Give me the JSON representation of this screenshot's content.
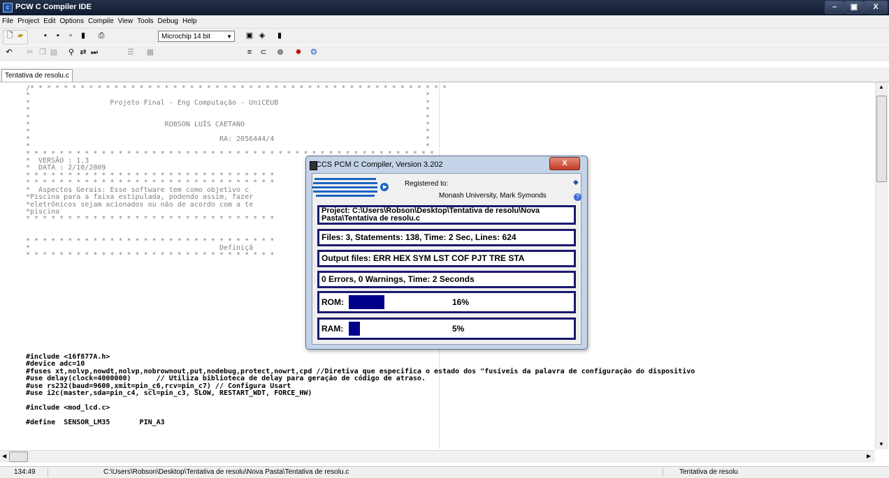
{
  "window": {
    "title": "PCW C Compiler IDE",
    "minimize": "–",
    "maximize": "▣",
    "close": "X"
  },
  "menu": [
    "File",
    "Project",
    "Edit",
    "Options",
    "Compile",
    "View",
    "Tools",
    "Debug",
    "Help"
  ],
  "toolbar": {
    "chip_select": "Microchip 14 bit"
  },
  "tab": {
    "label": "Tentativa de resolu.c"
  },
  "code_lines": [
    {
      "t": "/* * * * * * * * * * * * * * * * * * * * * * * * * * * * * * * * * * * * * * * * * * * * * * * * * *",
      "c": "cm"
    },
    {
      "t": "*                                                                                              *",
      "c": "cm"
    },
    {
      "t": "*                   Projeto Final - Eng Computação - UniCEUB                                   *",
      "c": "cm"
    },
    {
      "t": "*                                                                                              *",
      "c": "cm"
    },
    {
      "t": "*                                                                                              *",
      "c": "cm"
    },
    {
      "t": "*                                ROBSON LUÍS CAETANO                                           *",
      "c": "cm"
    },
    {
      "t": "*                                                                                              *",
      "c": "cm"
    },
    {
      "t": "*                                             RA: 2056444/4                                    *",
      "c": "cm"
    },
    {
      "t": "*                                                                                              *",
      "c": "cm"
    },
    {
      "t": "* * * * * * * * * * * * * * * * * * * * * * * * * * * * * * * * * * * * * * * * * * * * * * * * *",
      "c": "cm"
    },
    {
      "t": "*  VERSÃO : 1.3",
      "c": "cm"
    },
    {
      "t": "*  DATA : 2/10/2009",
      "c": "cm"
    },
    {
      "t": "* * * * * * * * * * * * * * * * * * * * * * * * * * * * * *",
      "c": "cm"
    },
    {
      "t": "* * * * * * * * * * * * * * * * * * * * * * * * * * * * * *",
      "c": "cm"
    },
    {
      "t": "*  Aspectos Gerais: Esse software tem como objetivo c",
      "c": "cm"
    },
    {
      "t": "*Piscina para a faixa estipulada, podendo assim, fazer",
      "c": "cm"
    },
    {
      "t": "*eletrônicos sejam acionados ou não de acordo com a te",
      "c": "cm"
    },
    {
      "t": "*piscina",
      "c": "cm"
    },
    {
      "t": "* * * * * * * * * * * * * * * * * * * * * * * * * * * * * *",
      "c": "cm"
    },
    {
      "t": "",
      "c": "cm"
    },
    {
      "t": "",
      "c": "cm"
    },
    {
      "t": "* * * * * * * * * * * * * * * * * * * * * * * * * * * * * *",
      "c": "cm"
    },
    {
      "t": "*                                             Definiçã",
      "c": "cm"
    },
    {
      "t": "* * * * * * * * * * * * * * * * * * * * * * * * * * * * * *",
      "c": "cm"
    },
    {
      "t": "",
      "c": "cm"
    },
    {
      "t": "",
      "c": "cm"
    },
    {
      "t": "",
      "c": "cm"
    },
    {
      "t": "",
      "c": "cm"
    },
    {
      "t": "",
      "c": "cm"
    },
    {
      "t": "",
      "c": "cm"
    },
    {
      "t": "",
      "c": "cm"
    },
    {
      "t": "",
      "c": "cm"
    },
    {
      "t": "",
      "c": "cm"
    },
    {
      "t": "",
      "c": "cm"
    },
    {
      "t": "",
      "c": "cm"
    },
    {
      "t": "",
      "c": "cm"
    },
    {
      "t": "",
      "c": "cm"
    },
    {
      "t": "#include <16f877A.h>",
      "c": "dir"
    },
    {
      "t": "#device adc=10",
      "c": "dir"
    },
    {
      "t": "#fuses xt,nolvp,nowdt,nolvp,nobrownout,put,nodebug,protect,nowrt,cpd //Diretiva que especifica o estado dos \"fusíveis da palavra de configuração do dispositivo",
      "c": "dir"
    },
    {
      "t": "#use delay(clock=4000000)      // Utiliza biblioteca de delay para geração de código de atraso.",
      "c": "dir"
    },
    {
      "t": "#use rs232(baud=9600,xmit=pin_c6,rcv=pin_c7) // Configura Usart",
      "c": "dir"
    },
    {
      "t": "#use i2c(master,sda=pin_c4, scl=pin_c3, SLOW, RESTART_WDT, FORCE_HW)",
      "c": "dir"
    },
    {
      "t": "",
      "c": "cm"
    },
    {
      "t": "#include <mod_lcd.c>",
      "c": "dir"
    },
    {
      "t": "",
      "c": "cm"
    },
    {
      "t": "#define  SENSOR_LM35       PIN_A3",
      "c": "dir"
    }
  ],
  "status": {
    "position": "134:49",
    "path": "C:\\Users\\Robson\\Desktop\\Tentativa de resolu\\Nova Pasta\\Tentativa de resolu.c",
    "project": "Tentativa de resolu"
  },
  "dialog": {
    "title": "CCS PCM C Compiler, Version 3.202",
    "close": "X",
    "logo_text": "CCS",
    "registered_label": "Registered to:",
    "registered_name": "Monash University, Mark Symonds",
    "project": "Project:  C:\\Users\\Robson\\Desktop\\Tentativa de resolu\\Nova Pasta\\Tentativa de resolu.c",
    "files": "Files: 3,  Statements: 138,  Time: 2 Sec,  Lines: 624",
    "output": "Output files: ERR  HEX  SYM  LST  COF  PJT  TRE  STA",
    "errors": "0 Errors,  0 Warnings,  Time: 2 Seconds",
    "rom_label": "ROM:",
    "rom_pct": "16%",
    "rom_value": 0.16,
    "ram_label": "RAM:",
    "ram_pct": "5%",
    "ram_value": 0.05
  }
}
